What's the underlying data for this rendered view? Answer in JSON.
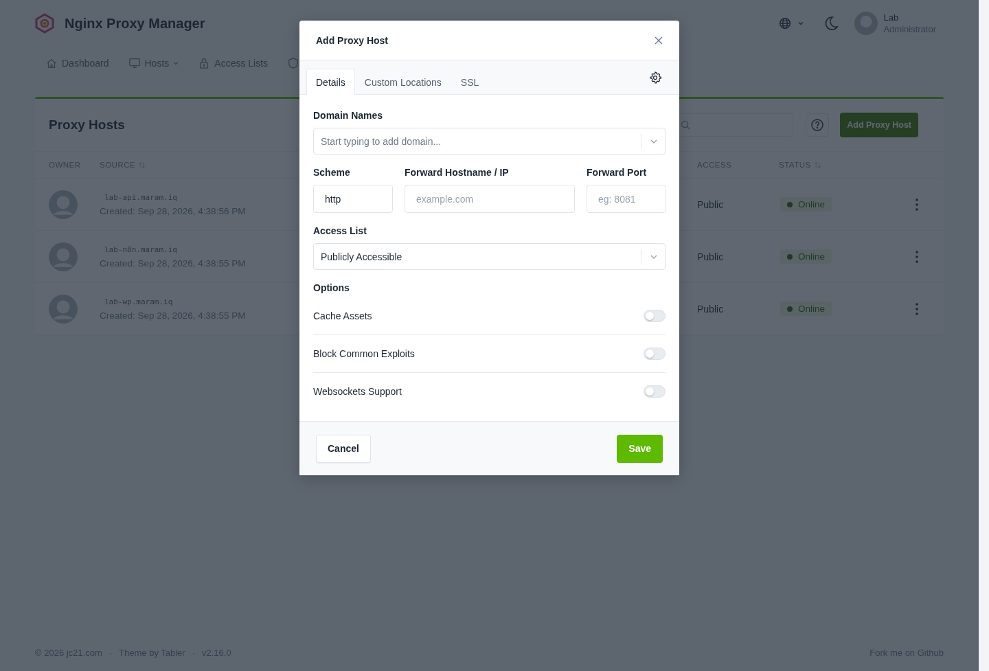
{
  "header": {
    "brand": "Nginx Proxy Manager",
    "user": {
      "name": "Lab",
      "role": "Administrator"
    }
  },
  "nav": [
    {
      "label": "Dashboard",
      "dropdown": false
    },
    {
      "label": "Hosts",
      "dropdown": true
    },
    {
      "label": "Access Lists",
      "dropdown": false
    }
  ],
  "card": {
    "title": "Proxy Hosts",
    "add_button": "Add Proxy Host",
    "columns": [
      {
        "label": "OWNER",
        "sortable": false
      },
      {
        "label": "SOURCE",
        "sortable": true
      },
      {
        "label": "ACCESS",
        "sortable": false
      },
      {
        "label": "STATUS",
        "sortable": true
      }
    ],
    "rows": [
      {
        "source": "lab-api.maram.iq",
        "created": "Created: Sep 28, 2026, 4:38:56 PM",
        "access": "Public",
        "status": "Online"
      },
      {
        "source": "lab-n8n.maram.iq",
        "created": "Created: Sep 28, 2026, 4:38:55 PM",
        "access": "Public",
        "status": "Online"
      },
      {
        "source": "lab-wp.maram.iq",
        "created": "Created: Sep 28, 2026, 4:38:55 PM",
        "access": "Public",
        "status": "Online"
      }
    ]
  },
  "footer": {
    "left": [
      "© 2026 jc21.com",
      "·",
      "Theme by Tabler",
      "·",
      "v2.16.0"
    ],
    "right": "Fork me on Github"
  },
  "modal": {
    "title": "Add Proxy Host",
    "tabs": [
      {
        "label": "Details",
        "selected": true
      },
      {
        "label": "Custom Locations",
        "selected": false
      },
      {
        "label": "SSL",
        "selected": false
      }
    ],
    "domain": {
      "label": "Domain Names",
      "placeholder": "Start typing to add domain..."
    },
    "scheme": {
      "label": "Scheme",
      "value": "http"
    },
    "hostname": {
      "label": "Forward Hostname / IP",
      "placeholder": "example.com"
    },
    "port": {
      "label": "Forward Port",
      "placeholder": "eg: 8081"
    },
    "access": {
      "label": "Access List",
      "value": "Publicly Accessible"
    },
    "options_title": "Options",
    "options": [
      {
        "label": "Cache Assets",
        "on": false
      },
      {
        "label": "Block Common Exploits",
        "on": false
      },
      {
        "label": "Websockets Support",
        "on": false
      }
    ],
    "cancel": "Cancel",
    "save": "Save"
  }
}
